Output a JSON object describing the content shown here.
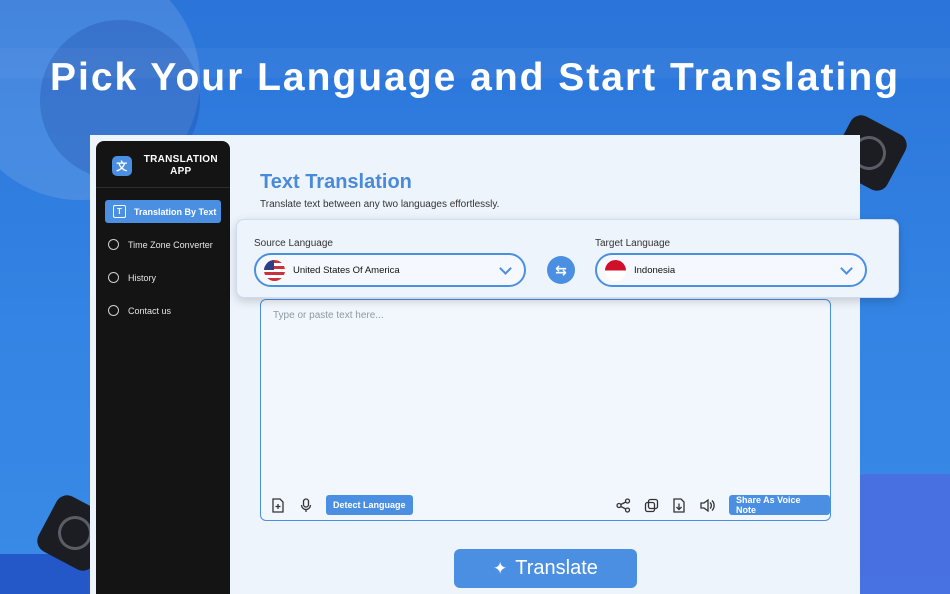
{
  "headline": "Pick Your Language and Start Translating",
  "brand": {
    "title": "TRANSLATION APP"
  },
  "sidebar": {
    "items": [
      {
        "label": "Translation By Text",
        "icon": "text-icon",
        "active": true
      },
      {
        "label": "Time Zone Converter",
        "icon": "location-pin-icon",
        "active": false
      },
      {
        "label": "History",
        "icon": "clock-icon",
        "active": false
      },
      {
        "label": "Contact us",
        "icon": "chat-bubble-icon",
        "active": false
      }
    ]
  },
  "main": {
    "title": "Text Translation",
    "subtitle": "Translate text between any two languages effortlessly."
  },
  "languages": {
    "source_label": "Source Language",
    "source_value": "United States Of America",
    "target_label": "Target Language",
    "target_value": "Indonesia"
  },
  "input": {
    "placeholder": "Type or paste text here...",
    "detect_label": "Detect Language",
    "share_voice_label": "Share As Voice Note"
  },
  "translate_label": "Translate",
  "colors": {
    "accent": "#4b8fe2",
    "background": "#2f7fe0",
    "sidebar": "#141414"
  }
}
